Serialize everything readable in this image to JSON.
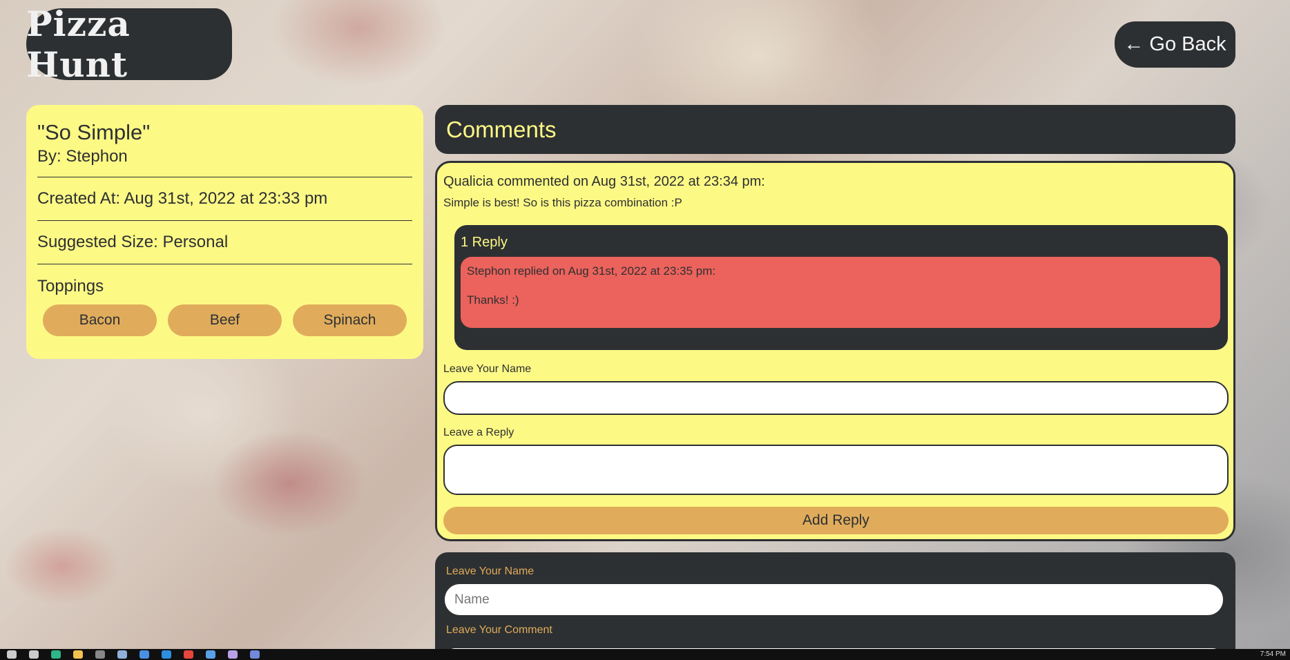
{
  "app": {
    "logo": "Pizza Hunt",
    "go_back": "← Go Back"
  },
  "pizza": {
    "title": "\"So Simple\"",
    "author": "By: Stephon",
    "created": "Created At: Aug 31st, 2022 at 23:33 pm",
    "size": "Suggested Size: Personal",
    "toppings_title": "Toppings",
    "toppings": [
      "Bacon",
      "Beef",
      "Spinach"
    ]
  },
  "comments": {
    "header": "Comments",
    "items": [
      {
        "meta": "Qualicia commented on Aug 31st, 2022 at 23:34 pm:",
        "text": "Simple is best! So is this pizza combination :P",
        "reply_count": "1 Reply",
        "replies": [
          {
            "meta": "Stephon replied on Aug 31st, 2022 at 23:35 pm:",
            "text": "Thanks! :)"
          }
        ],
        "reply_form": {
          "name_label": "Leave Your Name",
          "name_value": "",
          "reply_label": "Leave a Reply",
          "reply_value": "",
          "submit": "Add Reply"
        }
      }
    ]
  },
  "new_comment": {
    "name_label": "Leave Your Name",
    "name_placeholder": "Name",
    "comment_label": "Leave Your Comment"
  },
  "taskbar": {
    "clock": "7:54 PM",
    "icons": [
      "search-icon",
      "task-view-icon",
      "edge-icon",
      "file-explorer-icon",
      "app-icon",
      "steam-icon",
      "app-icon",
      "vscode-icon",
      "chrome-icon",
      "app-icon",
      "app-icon",
      "discord-icon"
    ],
    "icon_colors": [
      "#cccccc",
      "#cccccc",
      "#2fb58a",
      "#f2c14e",
      "#888888",
      "#8fb0d8",
      "#4a90e2",
      "#2d8fe0",
      "#e8453c",
      "#5aa0e6",
      "#b8a0e8",
      "#7289da"
    ]
  }
}
